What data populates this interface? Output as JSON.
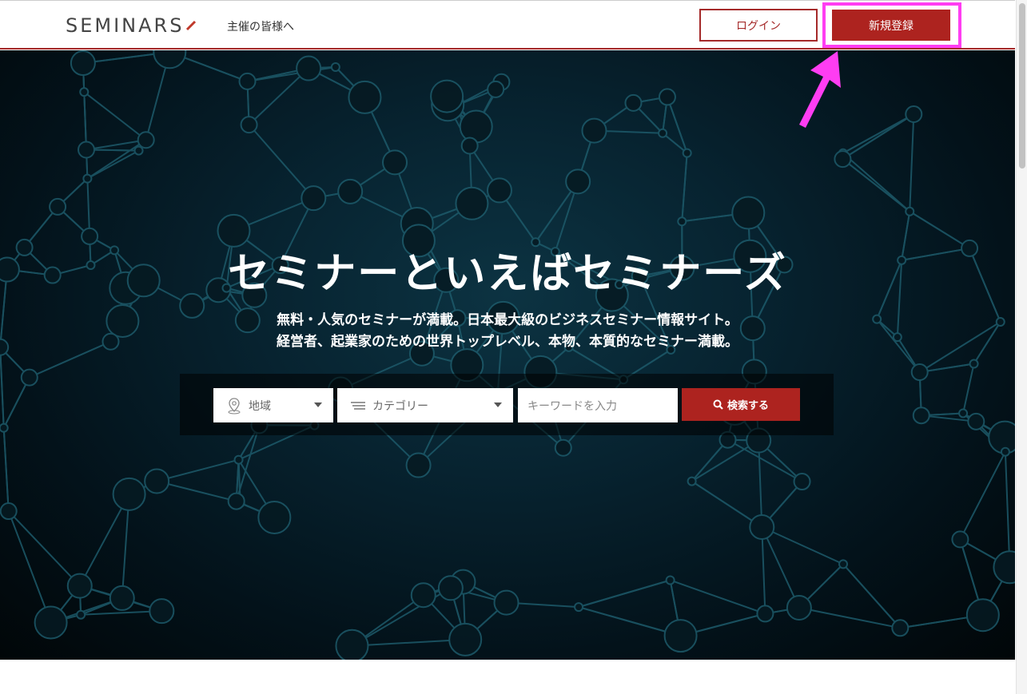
{
  "header": {
    "logo_text": "SEMINARS",
    "org_link": "主催の皆様へ",
    "login_label": "ログイン",
    "register_label": "新規登録"
  },
  "hero": {
    "headline": "セミナーといえばセミナーズ",
    "sub_line1": "無料・人気のセミナーが満載。日本最大級のビジネスセミナー情報サイト。",
    "sub_line2": "経営者、起業家のための世界トップレベル、本物、本質的なセミナー満載。"
  },
  "search": {
    "region_label": "地域",
    "category_label": "カテゴリー",
    "keyword_placeholder": "キーワードを入力",
    "submit_label": "検索する"
  },
  "colors": {
    "accent": "#ad231f",
    "highlight": "#ff3df2",
    "hero_bg": "#072330",
    "network_line": "#1d5a6a"
  },
  "icons": [
    "location-pin-icon",
    "list-icon",
    "chevron-down-icon",
    "search-icon",
    "pointer-arrow-icon"
  ]
}
